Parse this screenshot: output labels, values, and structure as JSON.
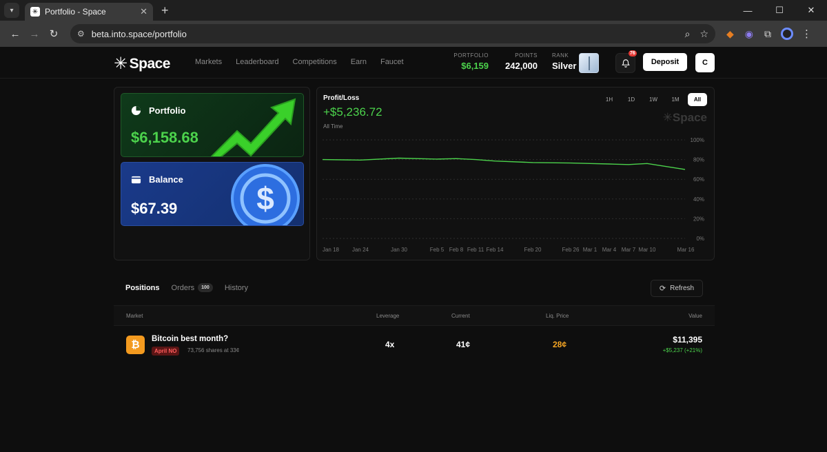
{
  "browser": {
    "tab_title": "Portfolio - Space",
    "url": "beta.into.space/portfolio"
  },
  "header": {
    "logo_text": "Space",
    "nav": [
      "Markets",
      "Leaderboard",
      "Competitions",
      "Earn",
      "Faucet"
    ],
    "portfolio_label": "PORTFOLIO",
    "portfolio_value": "$6,159",
    "points_label": "POINTS",
    "points_value": "242,000",
    "rank_label": "RANK",
    "rank_value": "Silver",
    "notifications": "76",
    "deposit_label": "Deposit",
    "avatar_initial": "C"
  },
  "cards": {
    "portfolio_title": "Portfolio",
    "portfolio_value": "$6,158.68",
    "balance_title": "Balance",
    "balance_value": "$67.39"
  },
  "pnl": {
    "title": "Profit/Loss",
    "value": "+$5,236.72",
    "period": "All Time",
    "ranges": [
      "1H",
      "1D",
      "1W",
      "1M",
      "All"
    ],
    "active_range": "All",
    "watermark": "Space"
  },
  "chart_data": {
    "type": "line",
    "x": [
      "Jan 18",
      "Jan 24",
      "Jan 30",
      "Feb 5",
      "Feb 8",
      "Feb 11",
      "Feb 14",
      "Feb 20",
      "Feb 26",
      "Mar 1",
      "Mar 4",
      "Mar 7",
      "Mar 10",
      "Mar 16"
    ],
    "values": [
      80,
      79.5,
      81.5,
      80.5,
      81,
      80,
      78.5,
      77,
      76.5,
      76,
      75.5,
      75,
      76,
      70
    ],
    "yticks": [
      "100%",
      "80%",
      "60%",
      "40%",
      "20%",
      "0%"
    ],
    "ylim": [
      0,
      100
    ],
    "line_color": "#4cd34c",
    "grid": true
  },
  "positions": {
    "tabs": [
      "Positions",
      "Orders",
      "History"
    ],
    "orders_count": "100",
    "refresh_label": "Refresh",
    "columns": [
      "Market",
      "Leverage",
      "Current",
      "Liq. Price",
      "Value"
    ],
    "rows": [
      {
        "market": "Bitcoin best month?",
        "side": "April NO",
        "shares": "73,756 shares at 33¢",
        "leverage": "4x",
        "current": "41¢",
        "liq_price": "28¢",
        "value": "$11,395",
        "pnl": "+$5,237 (+21%)"
      }
    ]
  },
  "colors": {
    "accent_green": "#4cd34c",
    "liq_orange": "#f5a524",
    "badge_red": "#ff5c5c"
  }
}
